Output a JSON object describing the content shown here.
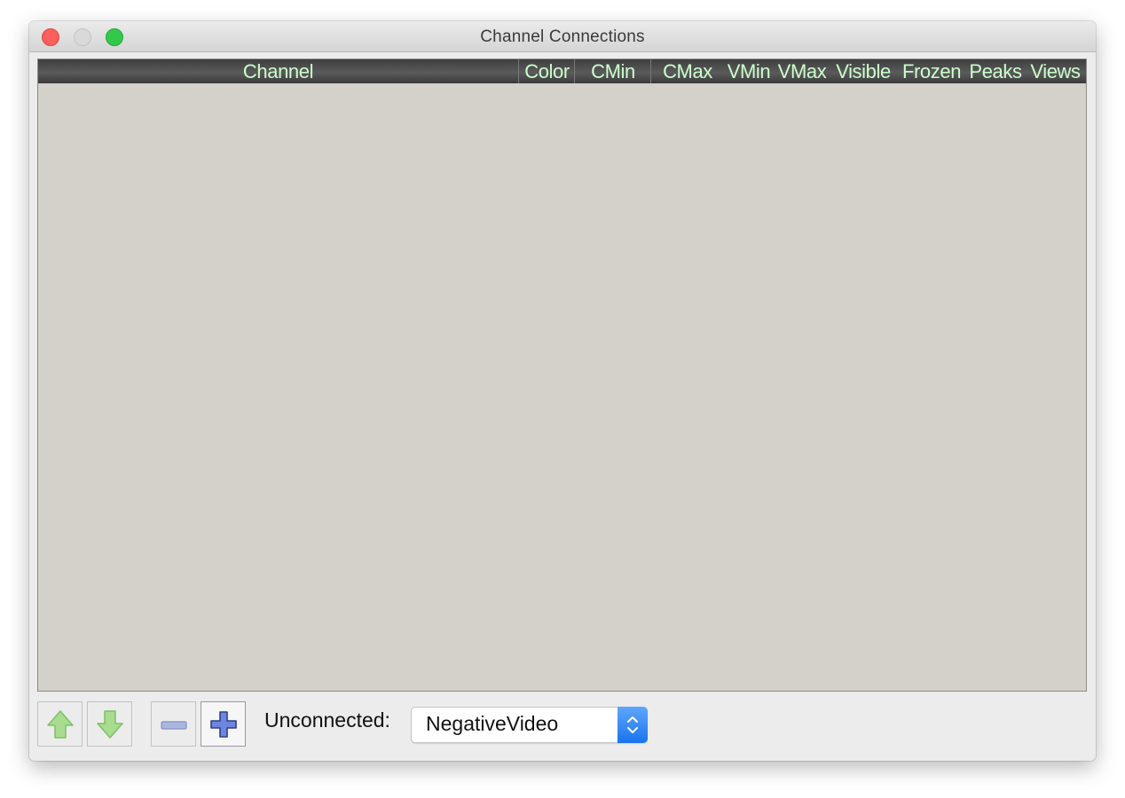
{
  "window": {
    "title": "Channel Connections"
  },
  "table": {
    "columns": [
      "Channel",
      "Color",
      "CMin",
      "CMax",
      "VMin",
      "VMax",
      "Visible",
      "Frozen",
      "Peaks",
      "Views"
    ],
    "rows": []
  },
  "toolbar": {
    "buttons": [
      "up-arrow-icon",
      "down-arrow-icon",
      "minus-icon",
      "plus-icon"
    ],
    "unconnected_label": "Unconnected:",
    "unconnected_selected": "NegativeVideo"
  },
  "colors": {
    "header_bg": "#4a4a4a",
    "header_text": "#ccffcc",
    "table_bg": "#d4d0ca",
    "combo_accent": "#2f84f4"
  }
}
